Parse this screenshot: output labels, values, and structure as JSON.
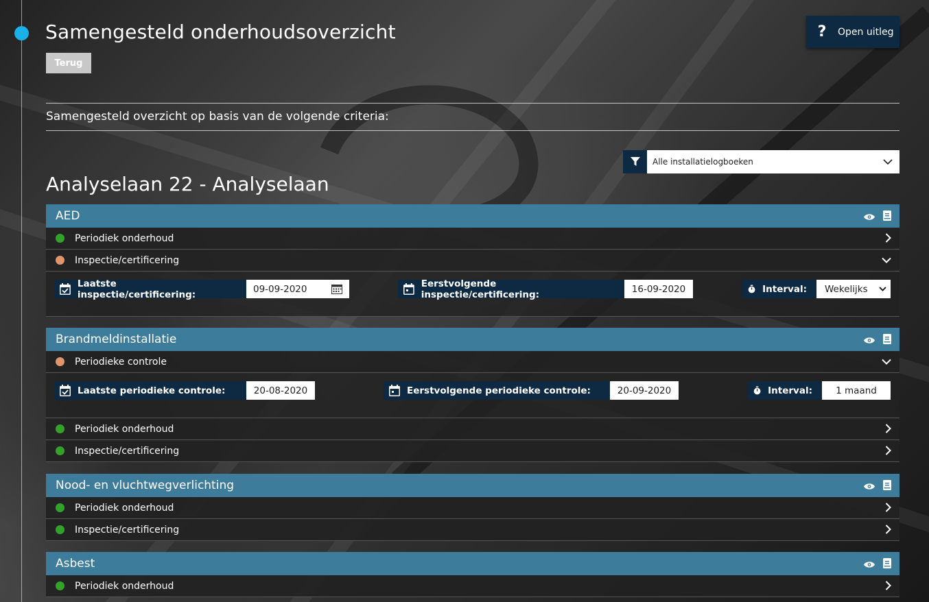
{
  "header": {
    "title": "Samengesteld onderhoudsoverzicht",
    "back_label": "Terug",
    "help_label": "Open uitleg",
    "help_icon": "?"
  },
  "criteria_text": "Samengesteld overzicht op basis van de volgende criteria:",
  "filter": {
    "selected": "Alle installatielogboeken"
  },
  "location": "Analyselaan 22 - Analyselaan",
  "colors": {
    "accent": "#3e7c9c",
    "dark": "#0d2a42",
    "timeline": "#1ab0e8",
    "green": "#33a12a",
    "orange": "#e0956a"
  },
  "groups": [
    {
      "name": "AED",
      "rows": [
        {
          "label": "Periodiek onderhoud",
          "status": "green",
          "expanded": false
        },
        {
          "label": "Inspectie/certificering",
          "status": "orange",
          "expanded": true,
          "detail": {
            "last_label": "Laatste inspectie/certificering:",
            "last_value": "09-09-2020",
            "next_label": "Eerstvolgende inspectie/certificering:",
            "next_value": "16-09-2020",
            "interval_label": "Interval:",
            "interval_value": "Wekelijks"
          }
        }
      ]
    },
    {
      "name": "Brandmeldinstallatie",
      "rows": [
        {
          "label": "Periodieke controle",
          "status": "orange",
          "expanded": true,
          "detail": {
            "last_label": "Laatste periodieke controle:",
            "last_value": "20-08-2020",
            "next_label": "Eerstvolgende periodieke controle:",
            "next_value": "20-09-2020",
            "interval_label": "Interval:",
            "interval_value": "1 maand"
          }
        },
        {
          "label": "Periodiek onderhoud",
          "status": "green",
          "expanded": false
        },
        {
          "label": "Inspectie/certificering",
          "status": "green",
          "expanded": false
        }
      ]
    },
    {
      "name": "Nood- en vluchtwegverlichting",
      "rows": [
        {
          "label": "Periodiek onderhoud",
          "status": "green",
          "expanded": false
        },
        {
          "label": "Inspectie/certificering",
          "status": "green",
          "expanded": false
        }
      ]
    },
    {
      "name": "Asbest",
      "rows": [
        {
          "label": "Periodiek onderhoud",
          "status": "green",
          "expanded": false
        }
      ]
    }
  ]
}
